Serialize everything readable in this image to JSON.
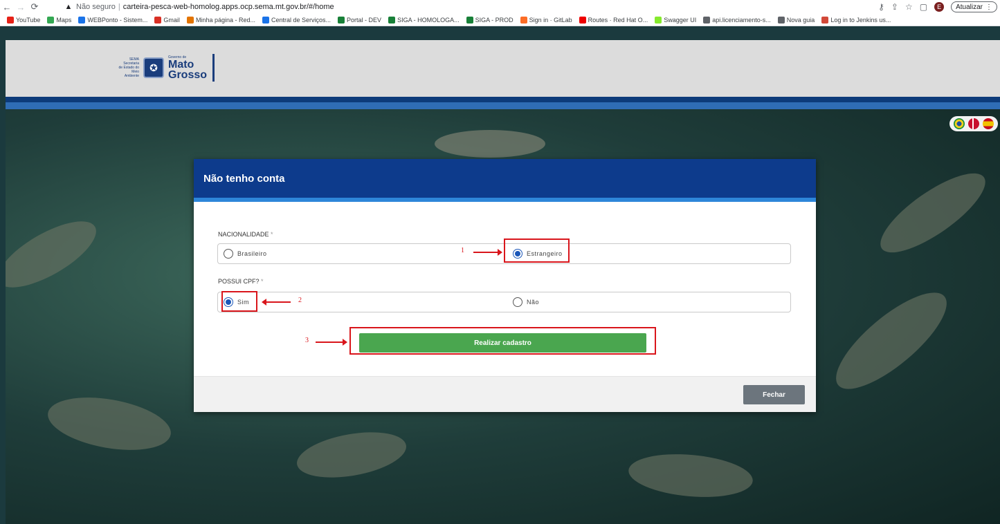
{
  "browser": {
    "insecure_label": "Não seguro",
    "url": "carteira-pesca-web-homolog.apps.ocp.sema.mt.gov.br/#/home",
    "update_label": "Atualizar",
    "avatar_letter": "E",
    "bookmarks": [
      {
        "label": "YouTube",
        "color": "#e62117"
      },
      {
        "label": "Maps",
        "color": "#34a853"
      },
      {
        "label": "WEBPonto - Sistem...",
        "color": "#1a73e8"
      },
      {
        "label": "Gmail",
        "color": "#d93025"
      },
      {
        "label": "Minha página - Red...",
        "color": "#e37400"
      },
      {
        "label": "Central de Serviços...",
        "color": "#1a73e8"
      },
      {
        "label": "Portal - DEV",
        "color": "#188038"
      },
      {
        "label": "SIGA - HOMOLOGA...",
        "color": "#188038"
      },
      {
        "label": "SIGA - PROD",
        "color": "#188038"
      },
      {
        "label": "Sign in · GitLab",
        "color": "#fc6d26"
      },
      {
        "label": "Routes · Red Hat O...",
        "color": "#ee0000"
      },
      {
        "label": "Swagger UI",
        "color": "#85ea2d"
      },
      {
        "label": "api.licenciamento-s...",
        "color": "#5f6368"
      },
      {
        "label": "Nova guia",
        "color": "#5f6368"
      },
      {
        "label": "Log in to Jenkins us...",
        "color": "#d24939"
      }
    ]
  },
  "header": {
    "sema_lines": [
      "SEMA",
      "Secretaria",
      "de Estado do",
      "Meio Ambiente"
    ],
    "gov_label": "Governo de",
    "state_line1": "Mato",
    "state_line2": "Grosso"
  },
  "modal": {
    "title": "Não tenho conta",
    "nationality": {
      "label": "NACIONALIDADE",
      "required_mark": "*",
      "options": [
        "Brasileiro",
        "Estrangeiro"
      ],
      "selected": "Estrangeiro"
    },
    "cpf": {
      "label": "POSSUI CPF?",
      "required_mark": "*",
      "options": [
        "Sim",
        "Não"
      ],
      "selected": "Sim"
    },
    "submit_label": "Realizar cadastro",
    "close_label": "Fechar"
  },
  "annotations": {
    "one": "1",
    "two": "2",
    "three": "3",
    "color": "#d9151b"
  }
}
